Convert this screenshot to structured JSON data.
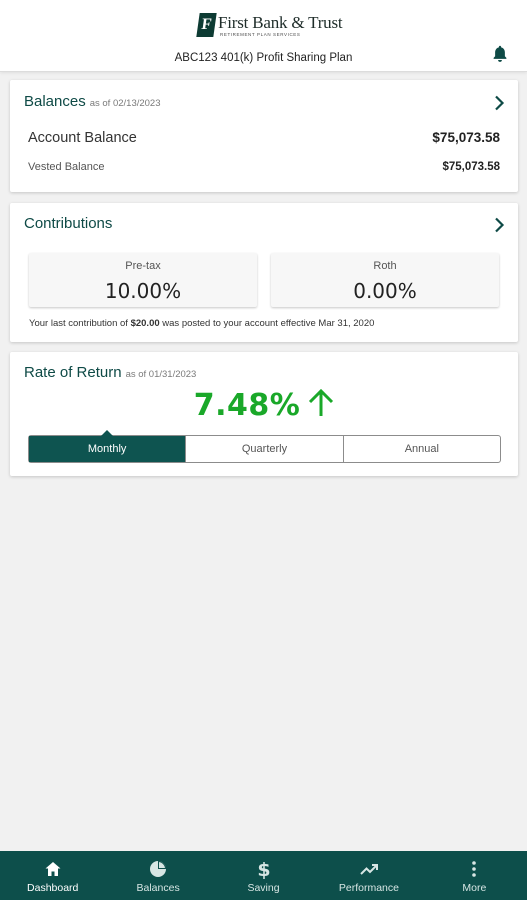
{
  "header": {
    "logo_mark": "F",
    "logo_text": "First Bank & Trust",
    "logo_subtitle": "RETIREMENT PLAN SERVICES",
    "plan_name": "ABC123 401(k) Profit Sharing Plan",
    "notification_icon": "bell-icon"
  },
  "balances": {
    "title": "Balances",
    "as_of": "as of 02/13/2023",
    "rows": [
      {
        "label": "Account Balance",
        "value": "$75,073.58"
      },
      {
        "label": "Vested Balance",
        "value": "$75,073.58"
      }
    ]
  },
  "contributions": {
    "title": "Contributions",
    "boxes": [
      {
        "label": "Pre-tax",
        "value": "10.00%"
      },
      {
        "label": "Roth",
        "value": "0.00%"
      }
    ],
    "note_prefix": "Your last contribution of ",
    "note_amount": "$20.00",
    "note_suffix": " was posted to your account effective Mar 31, 2020"
  },
  "rate_of_return": {
    "title": "Rate of Return",
    "as_of": "as of 01/31/2023",
    "value": "7.48%",
    "trend": "up",
    "periods": [
      "Monthly",
      "Quarterly",
      "Annual"
    ],
    "selected_period": "Monthly"
  },
  "tabbar": {
    "items": [
      {
        "label": "Dashboard",
        "icon": "home-icon",
        "active": true
      },
      {
        "label": "Balances",
        "icon": "pie-chart-icon",
        "active": false
      },
      {
        "label": "Saving",
        "icon": "dollar-icon",
        "active": false
      },
      {
        "label": "Performance",
        "icon": "trending-up-icon",
        "active": false
      },
      {
        "label": "More",
        "icon": "more-vertical-icon",
        "active": false
      }
    ]
  },
  "colors": {
    "brand": "#0e4a46",
    "tabbar": "#0d4f4b",
    "positive": "#1aa829",
    "background": "#f1f1f1"
  }
}
